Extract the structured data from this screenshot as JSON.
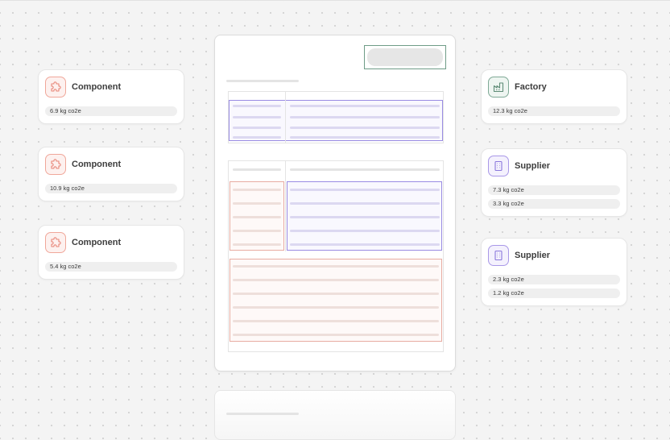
{
  "left_cards": [
    {
      "title": "Component",
      "icon": "puzzle-icon",
      "values": [
        "6.9 kg co2e"
      ]
    },
    {
      "title": "Component",
      "icon": "puzzle-icon",
      "values": [
        "10.9 kg co2e"
      ]
    },
    {
      "title": "Component",
      "icon": "puzzle-icon",
      "values": [
        "5.4 kg co2e"
      ]
    }
  ],
  "right_cards": [
    {
      "title": "Factory",
      "icon": "factory-icon",
      "values": [
        "12.3 kg co2e"
      ]
    },
    {
      "title": "Supplier",
      "icon": "building-icon",
      "values": [
        "7.3 kg co2e",
        "3.3 kg co2e"
      ]
    },
    {
      "title": "Supplier",
      "icon": "building-icon",
      "values": [
        "2.3 kg co2e",
        "1.2 kg co2e"
      ]
    }
  ],
  "colors": {
    "component_accent": "#f0a79a",
    "factory_accent": "#7fa996",
    "supplier_accent": "#a998e8",
    "highlight_purple": "#9a8ce3",
    "highlight_red": "#e8aca2",
    "highlight_green": "#6f9c87"
  }
}
